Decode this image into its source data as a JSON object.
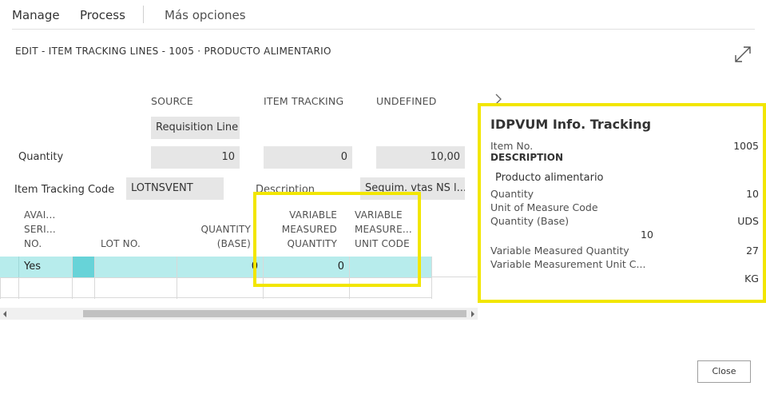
{
  "menu": {
    "manage": "Manage",
    "process": "Process",
    "more": "Más opciones"
  },
  "page_title": "EDIT - ITEM TRACKING LINES - 1005 · PRODUCTO ALIMENTARIO",
  "summary": {
    "col_headers": [
      "SOURCE",
      "ITEM TRACKING",
      "UNDEFINED"
    ],
    "source_type": "Requisition Line",
    "quantity_label": "Quantity",
    "quantity_values": [
      "10",
      "0",
      "10,00"
    ],
    "item_tracking_code_label": "Item Tracking Code",
    "item_tracking_code": "LOTNSVENT",
    "description_label": "Description",
    "description_value": "Seguim. vtas NS l..."
  },
  "grid": {
    "headers": {
      "avail": [
        "AVAI...",
        "SERI...",
        "NO."
      ],
      "lot": "LOT NO.",
      "qty_base": [
        "QUANTITY",
        "(BASE)"
      ],
      "var_qty": [
        "VARIABLE",
        "MEASURED",
        "QUANTITY"
      ],
      "var_unit": [
        "VARIABLE",
        "MEASURE...",
        "UNIT CODE"
      ]
    },
    "rows": [
      {
        "avail": "Yes",
        "lot": "",
        "qty_base": "0",
        "var_qty": "0",
        "var_unit": ""
      }
    ]
  },
  "factbox": {
    "title": "IDPVUM Info. Tracking",
    "item_no_label": "Item No.",
    "item_no": "1005",
    "description_label": "DESCRIPTION",
    "description": "Producto alimentario",
    "quantity_label": "Quantity",
    "quantity": "10",
    "uom_label": "Unit of Measure Code",
    "qty_base_label": "Quantity (Base)",
    "uom": "UDS",
    "qty_base": "10",
    "var_qty_label": "Variable Measured Quantity",
    "var_qty": "27",
    "var_unit_label": "Variable Measurement Unit C...",
    "var_unit": "KG"
  },
  "close_label": "Close",
  "colors": {
    "highlight": "#f2e600",
    "selected_row": "#b7ecec",
    "selected_marker": "#67d3d8"
  }
}
